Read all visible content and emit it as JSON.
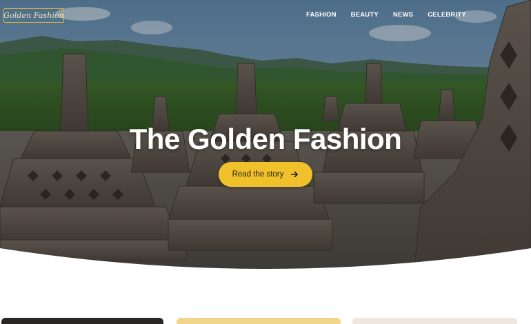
{
  "site": {
    "logo_text": "Golden Fashion"
  },
  "nav": {
    "items": [
      {
        "label": "FASHION"
      },
      {
        "label": "BEAUTY"
      },
      {
        "label": "NEWS"
      },
      {
        "label": "CELEBRITY"
      }
    ]
  },
  "hero": {
    "title": "The Golden Fashion",
    "cta_label": "Read the story"
  },
  "colors": {
    "accent": "#f1c12b",
    "logo_border": "#d9b24a",
    "text_light": "#ffffff"
  },
  "icons": {
    "cta_icon": "arrow-right-icon"
  }
}
